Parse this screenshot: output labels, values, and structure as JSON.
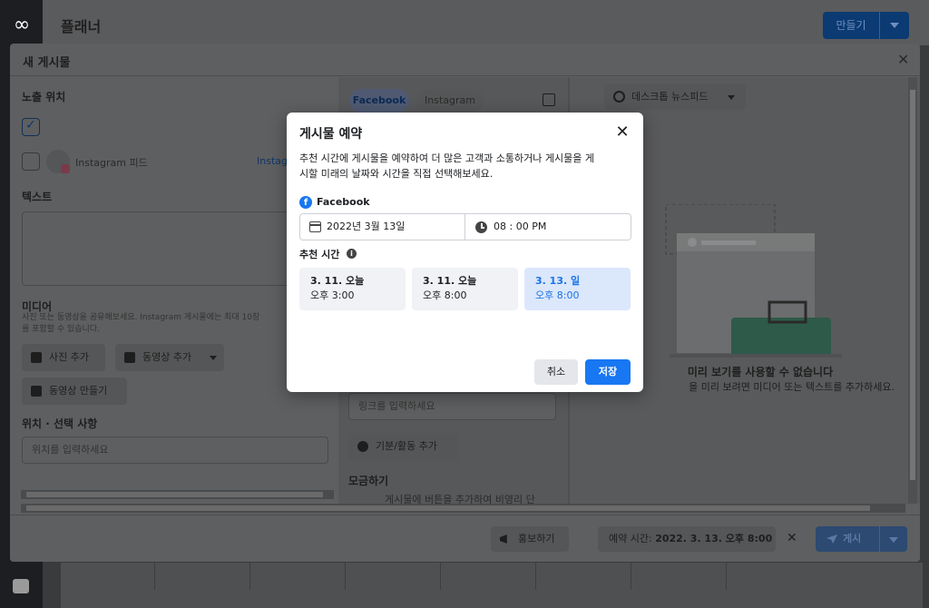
{
  "app": {
    "title": "플래너",
    "logo": "meta-logo-icon",
    "create_label": "만들기"
  },
  "composer": {
    "title": "새 게시물",
    "placement": {
      "label": "노출 위치",
      "items": [
        {
          "name": "",
          "checked": true
        },
        {
          "name": "Instagram 피드",
          "checked": false,
          "truncated_link": "Instag"
        }
      ]
    },
    "text_section": {
      "label": "텍스트"
    },
    "media": {
      "label": "미디어",
      "help_line1": "사진 또는 동영상을 공유해보세요. Instagram 게시물에는 최대 10장",
      "help_line2": "를 포함할 수 있습니다.",
      "add_photo": "사진 추가",
      "add_video": "동영상 추가",
      "create_video": "동영상 만들기"
    },
    "location": {
      "label": "위치 · 선택 사항",
      "placeholder": "위치를 입력하세요"
    },
    "mid": {
      "tabs": [
        "Facebook",
        "Instagram"
      ],
      "link_placeholder": "링크를 입력하세요",
      "feeling_label": "기분/활동 추가",
      "fundraise_label": "모금하기",
      "fundraise_desc": "게시물에 버튼을 추가하여 비영리 단"
    },
    "preview": {
      "placement_select": "데스크톱 뉴스피드",
      "unavailable_title": "미리 보기를 사용할 수 없습니다",
      "unavailable_desc": "을 미리 보려면 미디어 또는 텍스트를 추가하세요."
    },
    "footer": {
      "promote_label": "홍보하기",
      "schedule_prefix": "예약 시간:",
      "schedule_value": "2022. 3. 13. 오후 8:00",
      "post_label": "게시"
    }
  },
  "schedule_dialog": {
    "title": "게시물 예약",
    "description_line1": "추천 시간에 게시물을 예약하여 더 많은 고객과 소통하거나 게시물을 게",
    "description_line2": "시할 미래의 날짜와 시간을 직접 선택해보세요.",
    "platform": "Facebook",
    "date_value": "2022년 3월 13일",
    "time_value": "08 : 00 PM",
    "recommended_label": "추천 시간",
    "slots": [
      {
        "date": "3. 11. 오늘",
        "time": "오후 3:00",
        "selected": false
      },
      {
        "date": "3. 11. 오늘",
        "time": "오후 8:00",
        "selected": false
      },
      {
        "date": "3. 13. 일",
        "time": "오후 8:00",
        "selected": true
      }
    ],
    "cancel_label": "취소",
    "save_label": "저장"
  },
  "colors": {
    "accent": "#1877f2",
    "selected_slot_bg": "#dbe7fb",
    "selected_slot_text": "#1b74e4",
    "overlay": "#5e5f60"
  }
}
